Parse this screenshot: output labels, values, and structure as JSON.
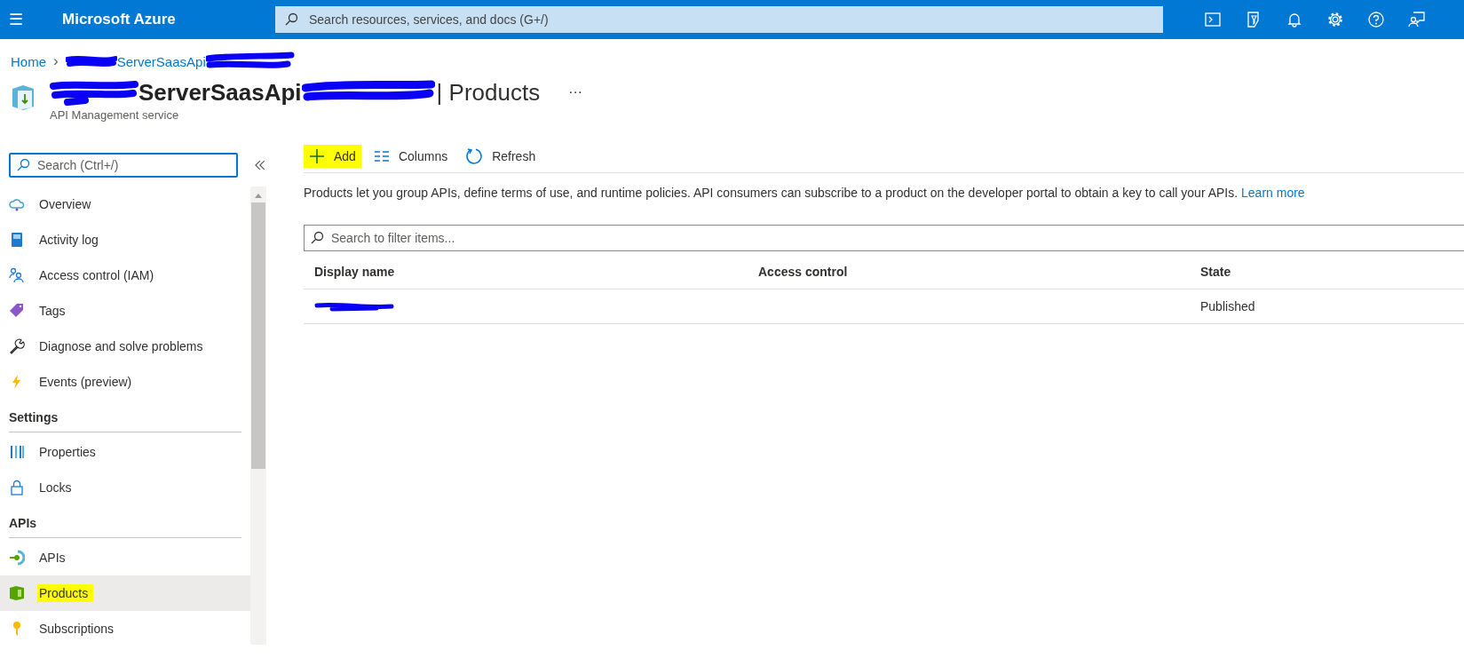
{
  "top_bar": {
    "menu_icon": "☰",
    "brand": "Microsoft Azure",
    "search": {
      "placeholder": "Search resources, services, and docs (G+/)"
    }
  },
  "breadcrumb": {
    "home": "Home",
    "separator": "›",
    "current": "ServerSaasApi"
  },
  "header": {
    "resource": "ServerSaasApi",
    "page": "| Products",
    "more": "···",
    "subtitle": "API Management service"
  },
  "sidebar": {
    "search": {
      "placeholder": "Search (Ctrl+/)"
    },
    "groups": [
      {
        "items": [
          {
            "label": "Overview",
            "selected": false,
            "highlighted": false
          },
          {
            "label": "Activity log",
            "selected": false,
            "highlighted": false
          },
          {
            "label": "Access control (IAM)",
            "selected": false,
            "highlighted": false
          },
          {
            "label": "Tags",
            "selected": false,
            "highlighted": false
          },
          {
            "label": "Diagnose and solve problems",
            "selected": false,
            "highlighted": false
          },
          {
            "label": "Events (preview)",
            "selected": false,
            "highlighted": false
          }
        ]
      },
      {
        "heading": "Settings",
        "items": [
          {
            "label": "Properties",
            "selected": false,
            "highlighted": false
          },
          {
            "label": "Locks",
            "selected": false,
            "highlighted": false
          }
        ]
      },
      {
        "heading": "APIs",
        "items": [
          {
            "label": "APIs",
            "selected": false,
            "highlighted": false
          },
          {
            "label": "Products",
            "selected": true,
            "highlighted": true
          },
          {
            "label": "Subscriptions",
            "selected": false,
            "highlighted": false
          }
        ]
      }
    ]
  },
  "toolbar": [
    {
      "label": "Add",
      "highlighted": true
    },
    {
      "label": "Columns",
      "highlighted": false
    },
    {
      "label": "Refresh",
      "highlighted": false
    }
  ],
  "description": {
    "text": "Products let you group APIs, define terms of use, and runtime policies. API consumers can subscribe to a product on the developer portal to obtain a key to call your APIs.",
    "link": "Learn more"
  },
  "filter": {
    "placeholder": "Search to filter items..."
  },
  "table": {
    "columns": [
      "Display name",
      "Access control",
      "State"
    ],
    "rows": [
      {
        "display_name_redacted": true,
        "access_control": "",
        "state": "Published"
      }
    ]
  }
}
